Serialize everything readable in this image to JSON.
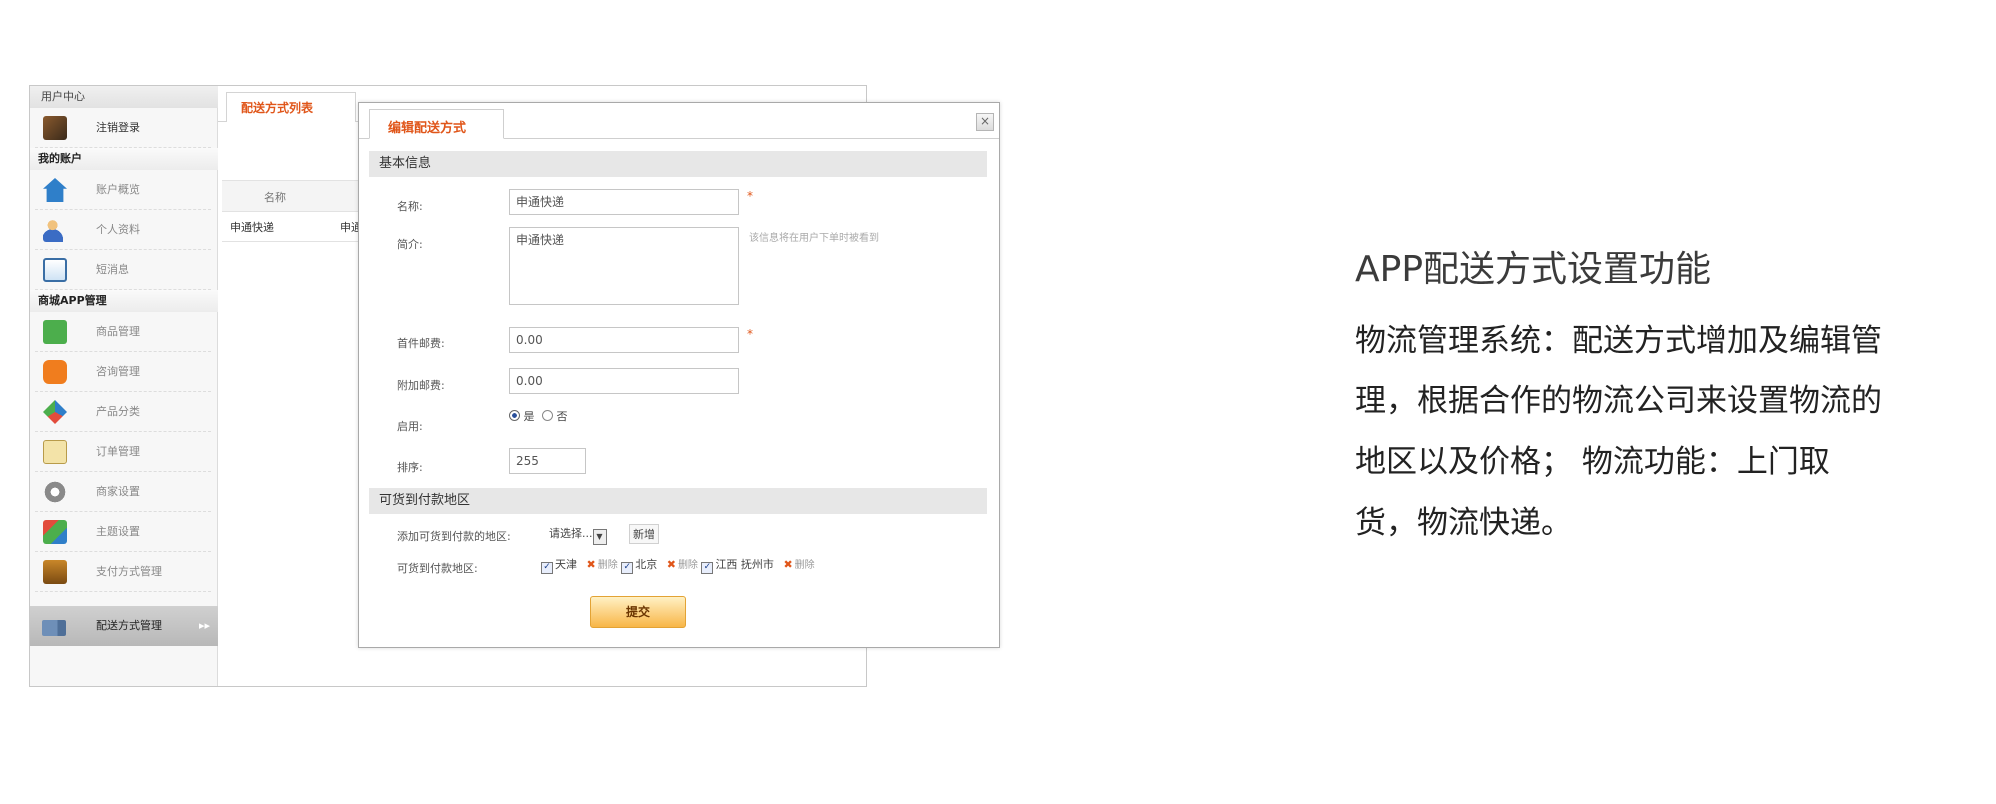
{
  "screenshot": {
    "sidebar": {
      "header": "用户中心",
      "logout": "注销登录",
      "sections": [
        "我的账户",
        "商城APP管理"
      ],
      "account_items": [
        "账户概览",
        "个人资料",
        "短消息"
      ],
      "app_items": [
        "商品管理",
        "咨询管理",
        "产品分类",
        "订单管理",
        "商家设置",
        "主题设置",
        "支付方式管理",
        "配送方式管理"
      ],
      "active_item": "配送方式管理"
    },
    "list": {
      "tab_label": "配送方式列表",
      "column_name": "名称",
      "row_name": "申通快递",
      "row_name_2": "申通"
    },
    "dialog": {
      "tab_label": "编辑配送方式",
      "close_label": "×",
      "basic_section": "基本信息",
      "name_label": "名称:",
      "name_value": "申通快递",
      "intro_label": "简介:",
      "intro_value": "申通快递",
      "intro_hint": "该信息将在用户下单时被看到",
      "first_fee_label": "首件邮费:",
      "first_fee_value": "0.00",
      "extra_fee_label": "附加邮费:",
      "extra_fee_value": "0.00",
      "enable_label": "启用:",
      "enable_yes": "是",
      "enable_no": "否",
      "required_mark": "*",
      "sort_label": "排序:",
      "sort_value": "255",
      "cod_section": "可货到付款地区",
      "add_area_label": "添加可货到付款的地区:",
      "select_placeholder": "请选择...",
      "add_button": "新增",
      "cod_area_label": "可货到付款地区:",
      "areas": [
        "天津",
        "北京",
        "江西 抚州市"
      ],
      "delete_label": "删除",
      "submit_label": "提交"
    }
  },
  "description": {
    "title": "APP配送方式设置功能",
    "lines": [
      "物流管理系统：配送方式增加及编辑管",
      "理，根据合作的物流公司来设置物流的",
      "地区以及价格； 物流功能：上门取",
      "货，物流快递。"
    ]
  }
}
